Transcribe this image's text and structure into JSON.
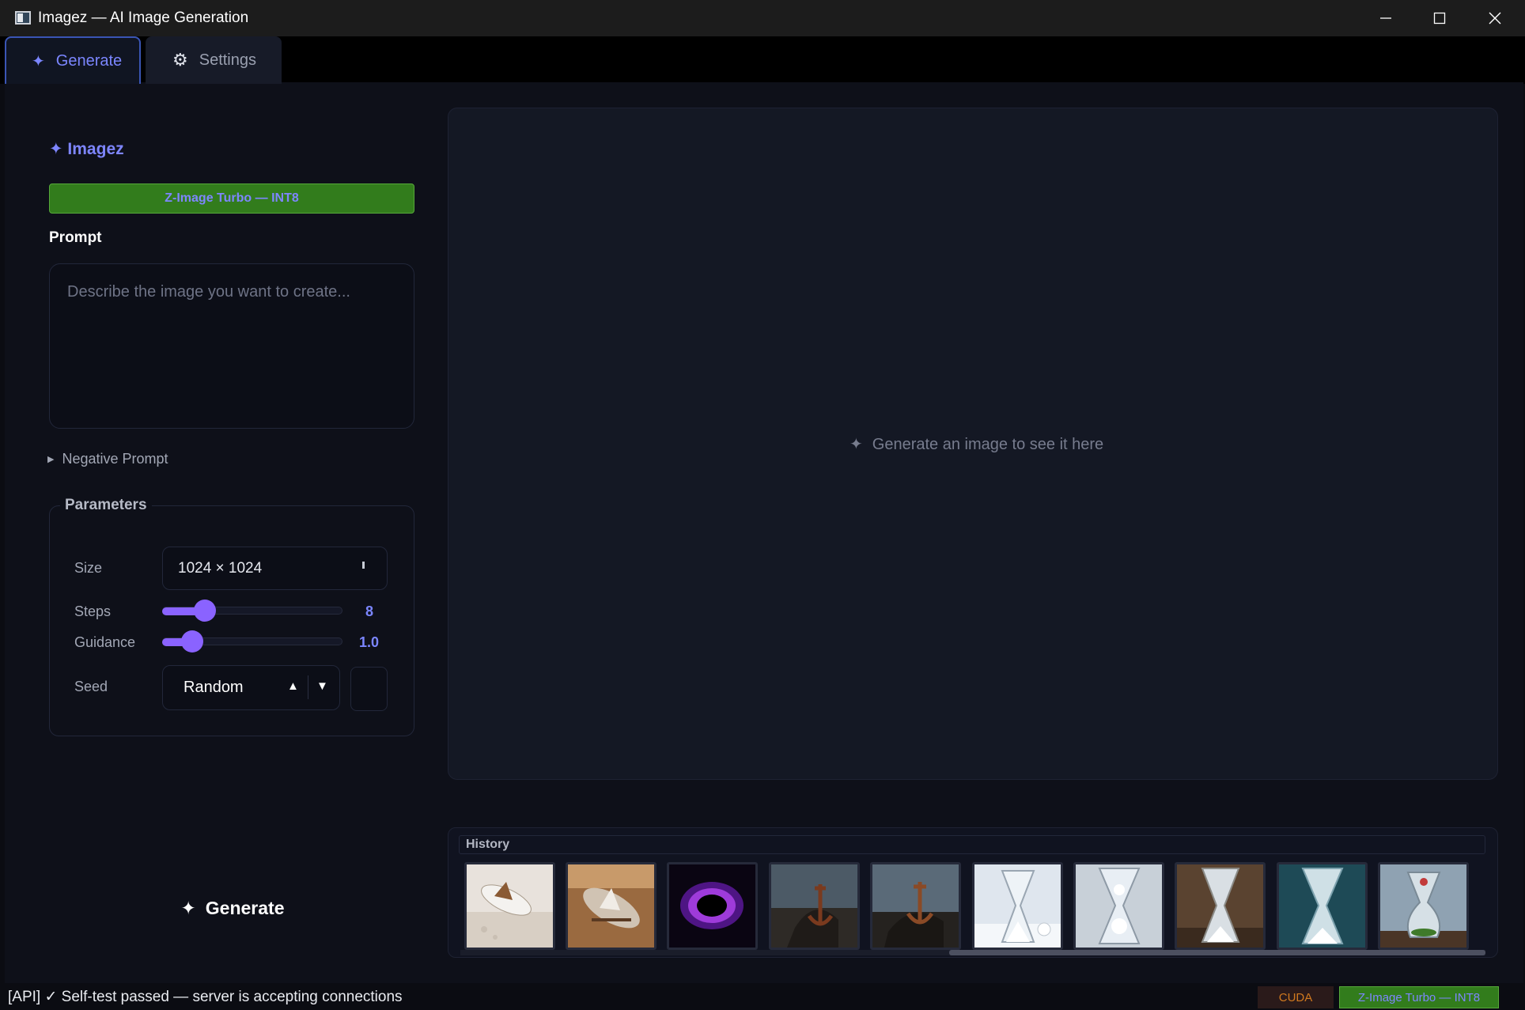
{
  "window": {
    "title": "Imagez — AI Image Generation"
  },
  "tabs": [
    {
      "label": "Generate",
      "icon": "sparkle-icon"
    },
    {
      "label": "Settings",
      "icon": "gear-icon"
    }
  ],
  "sidebar": {
    "brand": "✦ Imagez",
    "model_badge": "Z-Image Turbo — INT8",
    "prompt_label": "Prompt",
    "prompt_placeholder": "Describe the image you want to create...",
    "negative_prompt_label": "Negative Prompt",
    "parameters": {
      "legend": "Parameters",
      "size_label": "Size",
      "size_value": "1024 × 1024",
      "steps_label": "Steps",
      "steps_value": "8",
      "steps_fraction": 0.2,
      "guidance_label": "Guidance",
      "guidance_value": "1.0",
      "guidance_fraction": 0.12,
      "seed_label": "Seed",
      "seed_value": "Random"
    },
    "generate_label": "Generate"
  },
  "preview": {
    "hint": "Generate an image to see it here"
  },
  "history": {
    "title": "History",
    "items": [
      {
        "name": "ship-in-bottle-1"
      },
      {
        "name": "ship-in-bottle-2"
      },
      {
        "name": "purple-black-hole"
      },
      {
        "name": "anchor-on-rocks-1"
      },
      {
        "name": "anchor-on-rocks-2"
      },
      {
        "name": "hourglass-snowman-1"
      },
      {
        "name": "hourglass-snowman-2"
      },
      {
        "name": "hourglass-snowman-3"
      },
      {
        "name": "hourglass-blue"
      },
      {
        "name": "hourglass-terrarium"
      }
    ]
  },
  "status_bar": {
    "message": "[API] ✓ Self-test passed — server is accepting connections",
    "device": "CUDA",
    "model": "Z-Image Turbo — INT8"
  },
  "colors": {
    "accent": "#7b86ff",
    "slider": "#8a63ff",
    "model_badge_bg": "#327c1c"
  }
}
